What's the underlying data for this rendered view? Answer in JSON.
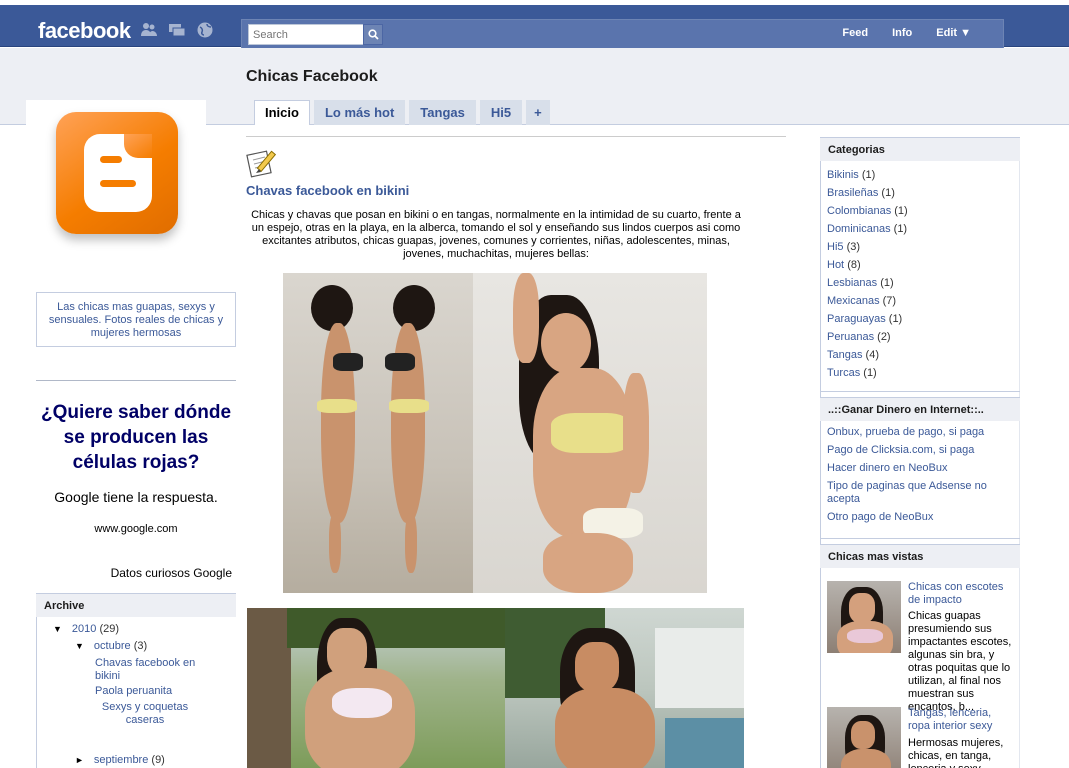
{
  "topbar": {
    "logo": "facebook",
    "search_placeholder": "Search",
    "nav": [
      "Feed",
      "Info",
      "Edit ▼"
    ]
  },
  "header": {
    "blog_title": "Chicas Facebook",
    "tabs": [
      "Inicio",
      "Lo más hot",
      "Tangas",
      "Hi5",
      "+"
    ]
  },
  "left": {
    "description": "Las chicas mas guapas, sexys y sensuales. Fotos reales de chicas y mujeres hermosas",
    "ad": {
      "title": "¿Quiere saber dónde se producen las células rojas?",
      "text": "Google tiene la respuesta.",
      "url": "www.google.com",
      "footer": "Datos curiosos Google"
    },
    "archive": {
      "heading": "Archive",
      "year": "2010",
      "year_count": "(29)",
      "month": "octubre",
      "month_count": "(3)",
      "posts": [
        "Chavas facebook en bikini",
        "Paola peruanita",
        "Sexys y coquetas caseras"
      ],
      "month2": "septiembre",
      "month2_count": "(9)"
    }
  },
  "post": {
    "title": "Chavas facebook en bikini",
    "body": "Chicas y chavas que posan en bikini o en tangas, normalmente en la intimidad de su cuarto, frente a un espejo, otras en la playa, en la alberca, tomando el sol y enseñando sus lindos cuerpos asi como excitantes atributos, chicas guapas, jovenes, comunes y corrientes, niñas, adolescentes, minas, jovenes, muchachitas, mujeres bellas:"
  },
  "right": {
    "categories_heading": "Categorias",
    "categories": [
      {
        "name": "Bikinis",
        "count": "(1)"
      },
      {
        "name": "Brasileñas",
        "count": "(1)"
      },
      {
        "name": "Colombianas",
        "count": "(1)"
      },
      {
        "name": "Dominicanas",
        "count": "(1)"
      },
      {
        "name": "Hi5",
        "count": "(3)"
      },
      {
        "name": "Hot",
        "count": "(8)"
      },
      {
        "name": "Lesbianas",
        "count": "(1)"
      },
      {
        "name": "Mexicanas",
        "count": "(7)"
      },
      {
        "name": "Paraguayas",
        "count": "(1)"
      },
      {
        "name": "Peruanas",
        "count": "(2)"
      },
      {
        "name": "Tangas",
        "count": "(4)"
      },
      {
        "name": "Turcas",
        "count": "(1)"
      }
    ],
    "money_heading": "..::Ganar Dinero en Internet::..",
    "money_links": [
      "Onbux, prueba de pago, si paga",
      "Pago de Clicksia.com, si paga",
      "Hacer dinero en NeoBux",
      "Tipo de paginas que Adsense no acepta",
      "Otro pago de NeoBux"
    ],
    "popular_heading": "Chicas mas vistas",
    "popular": [
      {
        "title": "Chicas con escotes de impacto",
        "text": "Chicas guapas presumiendo sus impactantes escotes, algunas sin bra, y otras poquitas que lo utilizan, al final nos muestran sus encantos, b..."
      },
      {
        "title": "Tangas, lenceria, ropa interior sexy",
        "text": "Hermosas mujeres, chicas, en tanga, lenceria y sexy..."
      }
    ]
  },
  "colors": {
    "fb_blue": "#3b5998",
    "band_grey": "#edeff4",
    "tab_bg": "#d8dfea"
  }
}
